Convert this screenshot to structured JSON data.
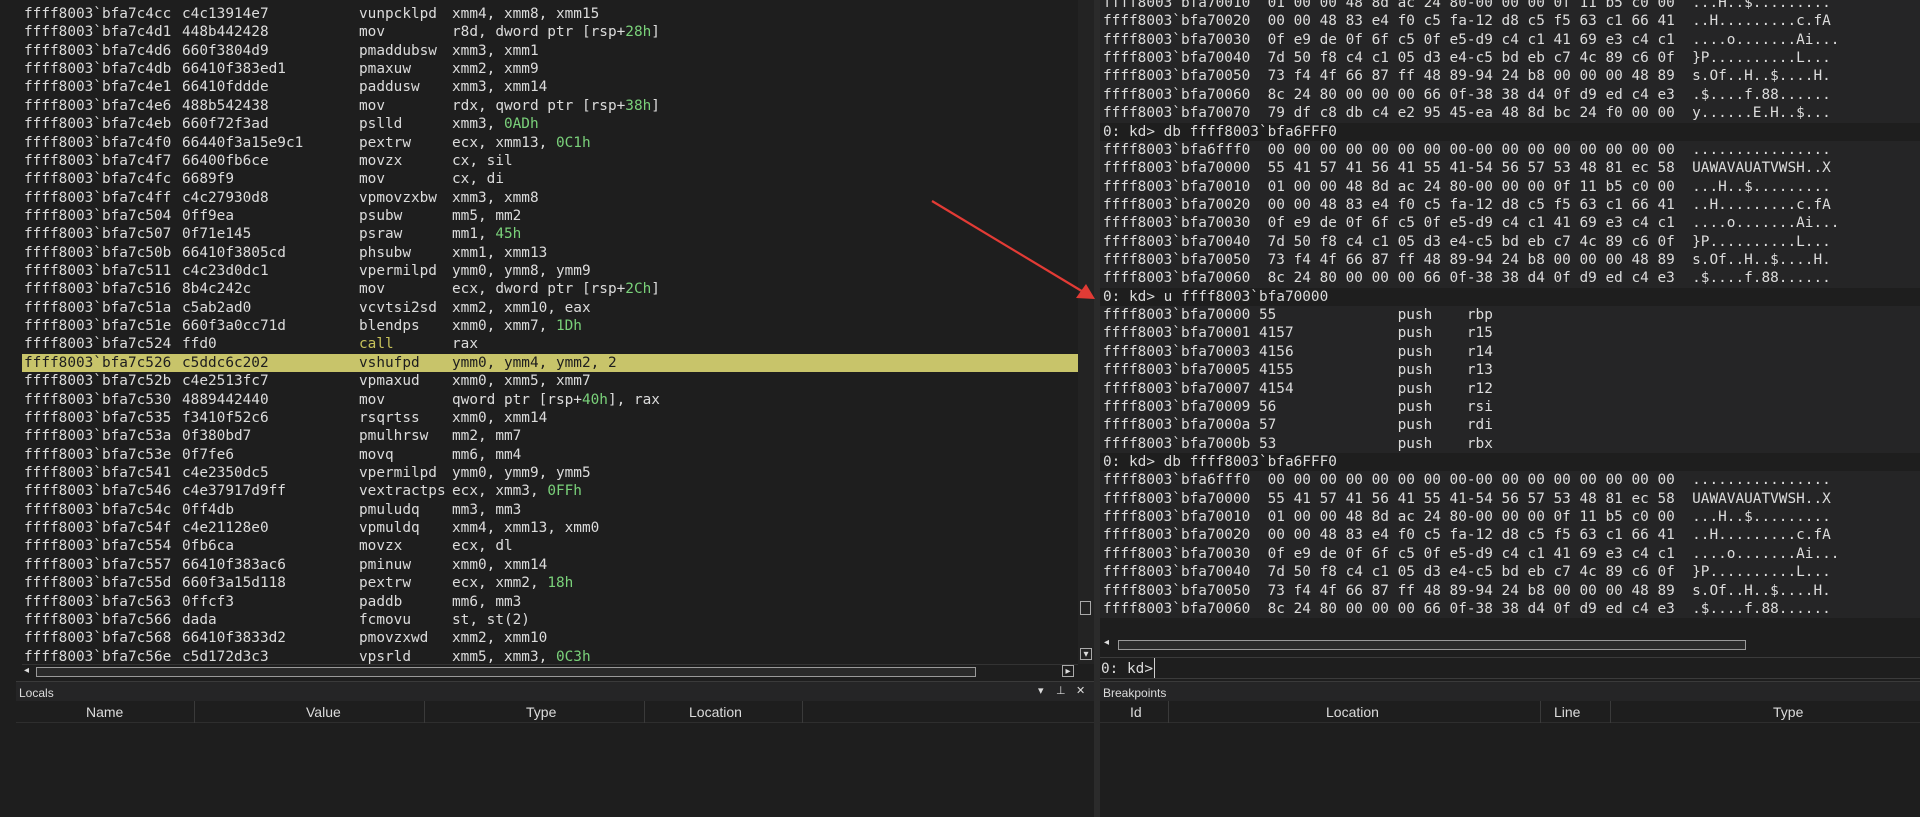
{
  "disassembly": {
    "lines": [
      {
        "addr": "ffff8003`bfa7c4cc",
        "bytes": "c4c13914e7",
        "mn": "vunpcklpd",
        "ops": "xmm4, xmm8, xmm15"
      },
      {
        "addr": "ffff8003`bfa7c4d1",
        "bytes": "448b442428",
        "mn": "mov",
        "ops": "r8d, dword ptr [rsp+",
        "num": "28h",
        "tail": "]"
      },
      {
        "addr": "ffff8003`bfa7c4d6",
        "bytes": "660f3804d9",
        "mn": "pmaddubsw",
        "ops": "xmm3, xmm1"
      },
      {
        "addr": "ffff8003`bfa7c4db",
        "bytes": "66410f383ed1",
        "mn": "pmaxuw",
        "ops": "xmm2, xmm9"
      },
      {
        "addr": "ffff8003`bfa7c4e1",
        "bytes": "66410fddde",
        "mn": "paddusw",
        "ops": "xmm3, xmm14"
      },
      {
        "addr": "ffff8003`bfa7c4e6",
        "bytes": "488b542438",
        "mn": "mov",
        "ops": "rdx, qword ptr [rsp+",
        "num": "38h",
        "tail": "]"
      },
      {
        "addr": "ffff8003`bfa7c4eb",
        "bytes": "660f72f3ad",
        "mn": "pslld",
        "ops": "xmm3, ",
        "num": "0ADh"
      },
      {
        "addr": "ffff8003`bfa7c4f0",
        "bytes": "66440f3a15e9c1",
        "mn": "pextrw",
        "ops": "ecx, xmm13, ",
        "num": "0C1h"
      },
      {
        "addr": "ffff8003`bfa7c4f7",
        "bytes": "66400fb6ce",
        "mn": "movzx",
        "ops": "cx, sil"
      },
      {
        "addr": "ffff8003`bfa7c4fc",
        "bytes": "6689f9",
        "mn": "mov",
        "ops": "cx, di"
      },
      {
        "addr": "ffff8003`bfa7c4ff",
        "bytes": "c4c27930d8",
        "mn": "vpmovzxbw",
        "ops": "xmm3, xmm8"
      },
      {
        "addr": "ffff8003`bfa7c504",
        "bytes": "0ff9ea",
        "mn": "psubw",
        "ops": "mm5, mm2"
      },
      {
        "addr": "ffff8003`bfa7c507",
        "bytes": "0f71e145",
        "mn": "psraw",
        "ops": "mm1, ",
        "num": "45h"
      },
      {
        "addr": "ffff8003`bfa7c50b",
        "bytes": "66410f3805cd",
        "mn": "phsubw",
        "ops": "xmm1, xmm13"
      },
      {
        "addr": "ffff8003`bfa7c511",
        "bytes": "c4c23d0dc1",
        "mn": "vpermilpd",
        "ops": "ymm0, ymm8, ymm9"
      },
      {
        "addr": "ffff8003`bfa7c516",
        "bytes": "8b4c242c",
        "mn": "mov",
        "ops": "ecx, dword ptr [rsp+",
        "num": "2Ch",
        "tail": "]"
      },
      {
        "addr": "ffff8003`bfa7c51a",
        "bytes": "c5ab2ad0",
        "mn": "vcvtsi2sd",
        "ops": "xmm2, xmm10, eax"
      },
      {
        "addr": "ffff8003`bfa7c51e",
        "bytes": "660f3a0cc71d",
        "mn": "blendps",
        "ops": "xmm0, xmm7, ",
        "num": "1Dh"
      },
      {
        "addr": "ffff8003`bfa7c524",
        "bytes": "ffd0",
        "mn": "call",
        "ops": "rax",
        "call": true
      },
      {
        "addr": "ffff8003`bfa7c526",
        "bytes": "c5ddc6c202",
        "mn": "vshufpd",
        "ops": "ymm0, ymm4, ymm2, 2",
        "hl": true
      },
      {
        "addr": "ffff8003`bfa7c52b",
        "bytes": "c4e2513fc7",
        "mn": "vpmaxud",
        "ops": "xmm0, xmm5, xmm7"
      },
      {
        "addr": "ffff8003`bfa7c530",
        "bytes": "4889442440",
        "mn": "mov",
        "ops": "qword ptr [rsp+",
        "num": "40h",
        "tail": "], rax"
      },
      {
        "addr": "ffff8003`bfa7c535",
        "bytes": "f3410f52c6",
        "mn": "rsqrtss",
        "ops": "xmm0, xmm14"
      },
      {
        "addr": "ffff8003`bfa7c53a",
        "bytes": "0f380bd7",
        "mn": "pmulhrsw",
        "ops": "mm2, mm7"
      },
      {
        "addr": "ffff8003`bfa7c53e",
        "bytes": "0f7fe6",
        "mn": "movq",
        "ops": "mm6, mm4"
      },
      {
        "addr": "ffff8003`bfa7c541",
        "bytes": "c4e2350dc5",
        "mn": "vpermilpd",
        "ops": "ymm0, ymm9, ymm5"
      },
      {
        "addr": "ffff8003`bfa7c546",
        "bytes": "c4e37917d9ff",
        "mn": "vextractps",
        "ops": "ecx, xmm3, ",
        "num": "0FFh"
      },
      {
        "addr": "ffff8003`bfa7c54c",
        "bytes": "0ff4db",
        "mn": "pmuludq",
        "ops": "mm3, mm3"
      },
      {
        "addr": "ffff8003`bfa7c54f",
        "bytes": "c4e21128e0",
        "mn": "vpmuldq",
        "ops": "xmm4, xmm13, xmm0"
      },
      {
        "addr": "ffff8003`bfa7c554",
        "bytes": "0fb6ca",
        "mn": "movzx",
        "ops": "ecx, dl"
      },
      {
        "addr": "ffff8003`bfa7c557",
        "bytes": "66410f383ac6",
        "mn": "pminuw",
        "ops": "xmm0, xmm14"
      },
      {
        "addr": "ffff8003`bfa7c55d",
        "bytes": "660f3a15d118",
        "mn": "pextrw",
        "ops": "ecx, xmm2, ",
        "num": "18h"
      },
      {
        "addr": "ffff8003`bfa7c563",
        "bytes": "0ffcf3",
        "mn": "paddb",
        "ops": "mm6, mm3"
      },
      {
        "addr": "ffff8003`bfa7c566",
        "bytes": "dada",
        "mn": "fcmovu",
        "ops": "st, st(2)"
      },
      {
        "addr": "ffff8003`bfa7c568",
        "bytes": "66410f3833d2",
        "mn": "pmovzxwd",
        "ops": "xmm2, xmm10"
      },
      {
        "addr": "ffff8003`bfa7c56e",
        "bytes": "c5d172d3c3",
        "mn": "vpsrld",
        "ops": "xmm5, xmm3, ",
        "num": "0C3h"
      }
    ]
  },
  "command": {
    "lines": [
      {
        "t": "ffff8003`bfa70010  01 00 00 48 8d ac 24 80-00 00 00 0f 11 b5 c0 00  ...H..$.........",
        "k": "out"
      },
      {
        "t": "ffff8003`bfa70020  00 00 48 83 e4 f0 c5 fa-12 d8 c5 f5 63 c1 66 41  ..H.........c.fA",
        "k": "out"
      },
      {
        "t": "ffff8003`bfa70030  0f e9 de 0f 6f c5 0f e5-d9 c4 c1 41 69 e3 c4 c1  ....o.......Ai...",
        "k": "out"
      },
      {
        "t": "ffff8003`bfa70040  7d 50 f8 c4 c1 05 d3 e4-c5 bd eb c7 4c 89 c6 0f  }P..........L...",
        "k": "out"
      },
      {
        "t": "ffff8003`bfa70050  73 f4 4f 66 87 ff 48 89-94 24 b8 00 00 00 48 89  s.Of..H..$....H.",
        "k": "out"
      },
      {
        "t": "ffff8003`bfa70060  8c 24 80 00 00 00 66 0f-38 38 d4 0f d9 ed c4 e3  .$....f.88......",
        "k": "out"
      },
      {
        "t": "ffff8003`bfa70070  79 df c8 db c4 e2 95 45-ea 48 8d bc 24 f0 00 00  y......E.H..$...",
        "k": "out"
      },
      {
        "t": "0: kd> db ffff8003`bfa6FFF0",
        "k": "prompt"
      },
      {
        "t": "ffff8003`bfa6fff0  00 00 00 00 00 00 00 00-00 00 00 00 00 00 00 00  ................",
        "k": "out"
      },
      {
        "t": "ffff8003`bfa70000  55 41 57 41 56 41 55 41-54 56 57 53 48 81 ec 58  UAWAVAUATVWSH..X",
        "k": "out"
      },
      {
        "t": "ffff8003`bfa70010  01 00 00 48 8d ac 24 80-00 00 00 0f 11 b5 c0 00  ...H..$.........",
        "k": "out"
      },
      {
        "t": "ffff8003`bfa70020  00 00 48 83 e4 f0 c5 fa-12 d8 c5 f5 63 c1 66 41  ..H.........c.fA",
        "k": "out"
      },
      {
        "t": "ffff8003`bfa70030  0f e9 de 0f 6f c5 0f e5-d9 c4 c1 41 69 e3 c4 c1  ....o.......Ai...",
        "k": "out"
      },
      {
        "t": "ffff8003`bfa70040  7d 50 f8 c4 c1 05 d3 e4-c5 bd eb c7 4c 89 c6 0f  }P..........L...",
        "k": "out"
      },
      {
        "t": "ffff8003`bfa70050  73 f4 4f 66 87 ff 48 89-94 24 b8 00 00 00 48 89  s.Of..H..$....H.",
        "k": "out"
      },
      {
        "t": "ffff8003`bfa70060  8c 24 80 00 00 00 66 0f-38 38 d4 0f d9 ed c4 e3  .$....f.88......",
        "k": "out"
      },
      {
        "t": "0: kd> u ffff8003`bfa70000",
        "k": "prompt"
      },
      {
        "t": "ffff8003`bfa70000 55              push    rbp",
        "k": "out"
      },
      {
        "t": "ffff8003`bfa70001 4157            push    r15",
        "k": "out"
      },
      {
        "t": "ffff8003`bfa70003 4156            push    r14",
        "k": "out"
      },
      {
        "t": "ffff8003`bfa70005 4155            push    r13",
        "k": "out"
      },
      {
        "t": "ffff8003`bfa70007 4154            push    r12",
        "k": "out"
      },
      {
        "t": "ffff8003`bfa70009 56              push    rsi",
        "k": "out"
      },
      {
        "t": "ffff8003`bfa7000a 57              push    rdi",
        "k": "out"
      },
      {
        "t": "ffff8003`bfa7000b 53              push    rbx",
        "k": "out"
      },
      {
        "t": "0: kd> db ffff8003`bfa6FFF0",
        "k": "prompt"
      },
      {
        "t": "ffff8003`bfa6fff0  00 00 00 00 00 00 00 00-00 00 00 00 00 00 00 00  ................",
        "k": "out"
      },
      {
        "t": "ffff8003`bfa70000  55 41 57 41 56 41 55 41-54 56 57 53 48 81 ec 58  UAWAVAUATVWSH..X",
        "k": "out"
      },
      {
        "t": "ffff8003`bfa70010  01 00 00 48 8d ac 24 80-00 00 00 0f 11 b5 c0 00  ...H..$.........",
        "k": "out"
      },
      {
        "t": "ffff8003`bfa70020  00 00 48 83 e4 f0 c5 fa-12 d8 c5 f5 63 c1 66 41  ..H.........c.fA",
        "k": "out"
      },
      {
        "t": "ffff8003`bfa70030  0f e9 de 0f 6f c5 0f e5-d9 c4 c1 41 69 e3 c4 c1  ....o.......Ai...",
        "k": "out"
      },
      {
        "t": "ffff8003`bfa70040  7d 50 f8 c4 c1 05 d3 e4-c5 bd eb c7 4c 89 c6 0f  }P..........L...",
        "k": "out"
      },
      {
        "t": "ffff8003`bfa70050  73 f4 4f 66 87 ff 48 89-94 24 b8 00 00 00 48 89  s.Of..H..$....H.",
        "k": "out"
      },
      {
        "t": "ffff8003`bfa70060  8c 24 80 00 00 00 66 0f-38 38 d4 0f d9 ed c4 e3  .$....f.88......",
        "k": "out"
      }
    ],
    "prompt_label": "0: kd>",
    "input_value": ""
  },
  "locals": {
    "title": "Locals",
    "columns": [
      "Name",
      "Value",
      "Type",
      "Location"
    ]
  },
  "breakpoints": {
    "title": "Breakpoints",
    "columns": [
      "Id",
      "Location",
      "Line",
      "Type"
    ]
  },
  "colors": {
    "background": "#1e1e1e",
    "highlight": "#c8c46a",
    "number": "#7ad17a",
    "call": "#c7c25a",
    "arrow": "#e23b35"
  },
  "icons": {
    "dropdown": "chevron-down-icon",
    "pin": "pin-icon",
    "close": "close-icon"
  }
}
